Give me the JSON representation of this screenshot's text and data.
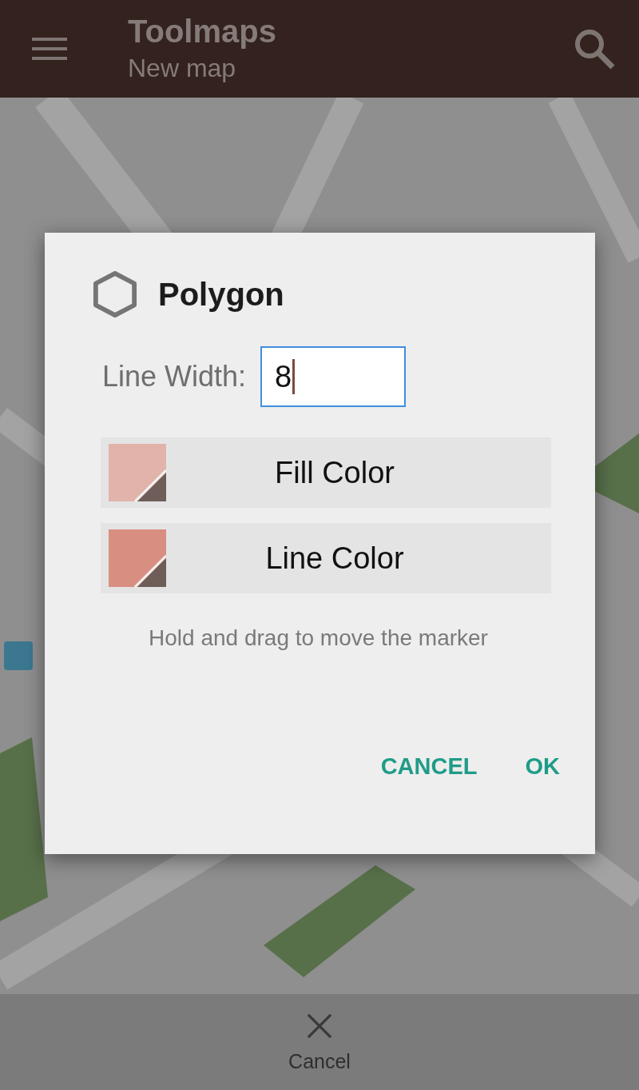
{
  "app_bar": {
    "title": "Toolmaps",
    "subtitle": "New map"
  },
  "dialog": {
    "title": "Polygon",
    "line_width": {
      "label": "Line Width:",
      "value": "8"
    },
    "color_buttons": [
      {
        "label": "Fill Color",
        "color": "#e2b3ab"
      },
      {
        "label": "Line Color",
        "color": "#d98e82"
      }
    ],
    "hint": "Hold and drag to move the marker",
    "actions": [
      "CANCEL",
      "OK"
    ]
  },
  "bottom_bar": {
    "label": "Cancel"
  }
}
